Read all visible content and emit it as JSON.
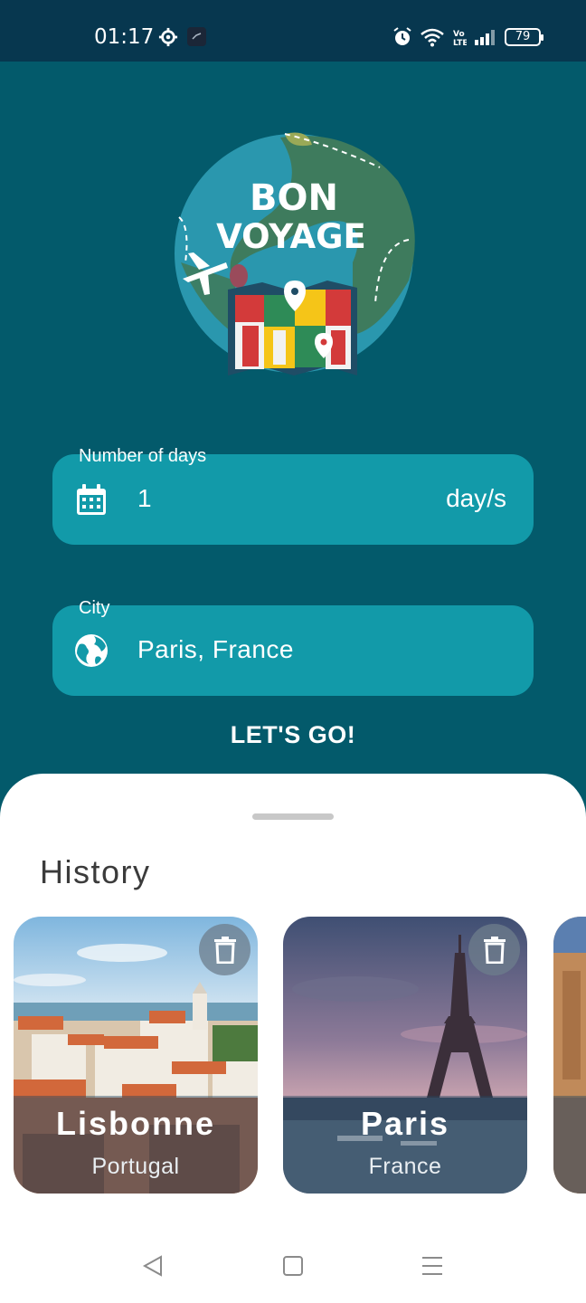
{
  "status_bar": {
    "time": "01:17",
    "battery": "79",
    "icons": [
      "gear-icon",
      "message-icon",
      "alarm-icon",
      "wifi-icon",
      "volte-icon",
      "signal-icon",
      "battery-icon"
    ]
  },
  "logo": {
    "line1": "BON",
    "line2": "VOYAGE"
  },
  "days_field": {
    "label": "Number of days",
    "value": "1",
    "suffix": "day/s",
    "icon": "calendar-icon"
  },
  "city_field": {
    "label": "City",
    "value": "Paris, France",
    "icon": "globe-icon"
  },
  "go_button": {
    "label": "LET'S GO!"
  },
  "history": {
    "title": "History",
    "cards": [
      {
        "city": "Lisbonne",
        "country": "Portugal"
      },
      {
        "city": "Paris",
        "country": "France"
      },
      {
        "city": "",
        "country": ""
      }
    ]
  },
  "nav_bar": {
    "icons": [
      "back-icon",
      "home-icon",
      "recents-icon"
    ]
  },
  "colors": {
    "background": "#035a6b",
    "status_bar": "#07374f",
    "field": "#129aa9",
    "sheet": "#ffffff"
  }
}
